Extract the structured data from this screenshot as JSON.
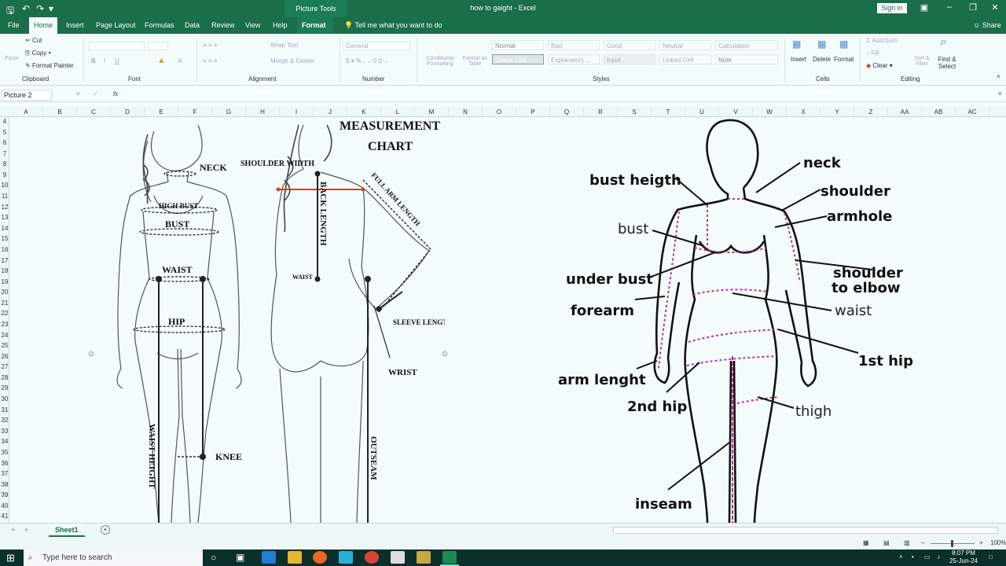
{
  "titlebar": {
    "context_tab": "Picture Tools",
    "document_title": "how to gaight  -  Excel",
    "sign_in": "Sign in"
  },
  "tabs": [
    "File",
    "Home",
    "Insert",
    "Page Layout",
    "Formulas",
    "Data",
    "Review",
    "View",
    "Help",
    "Format"
  ],
  "tell_me": "Tell me what you want to do",
  "share": "Share",
  "ribbon": {
    "clipboard": {
      "label": "Clipboard",
      "cut": "Cut",
      "copy": "Copy",
      "format_painter": "Format Painter",
      "paste": "Paste"
    },
    "font": {
      "label": "Font"
    },
    "alignment": {
      "label": "Alignment",
      "wrap_text": "Wrap Text",
      "merge_center": "Merge & Center"
    },
    "number": {
      "label": "Number",
      "format": "General"
    },
    "styles": {
      "label": "Styles",
      "conditional": "Conditional Formatting",
      "format_as_table": "Format as Table",
      "cells": [
        "Normal",
        "Bad",
        "Good",
        "Neutral",
        "Calculation",
        "Check Cell",
        "Explanatory ...",
        "Input",
        "Linked Cell",
        "Note"
      ]
    },
    "cells": {
      "label": "Cells",
      "insert": "Insert",
      "delete": "Delete",
      "format": "Format"
    },
    "editing": {
      "label": "Editing",
      "autosum": "AutoSum",
      "fill": "Fill",
      "clear": "Clear",
      "sort_filter": "Sort & Filter",
      "find_select": "Find & Select"
    }
  },
  "formula_bar": {
    "name_box": "Picture 2",
    "fx": "fx"
  },
  "columns": [
    "A",
    "B",
    "C",
    "D",
    "E",
    "F",
    "G",
    "H",
    "I",
    "J",
    "K",
    "L",
    "M",
    "N",
    "O",
    "P",
    "Q",
    "R",
    "S",
    "T",
    "U",
    "V",
    "W",
    "X",
    "Y",
    "Z",
    "AA",
    "AB",
    "AC"
  ],
  "rows": [
    "4",
    "5",
    "6",
    "7",
    "8",
    "9",
    "10",
    "11",
    "12",
    "13",
    "14",
    "15",
    "16",
    "17",
    "18",
    "19",
    "20",
    "21",
    "22",
    "23",
    "24",
    "25",
    "26",
    "27",
    "28",
    "29",
    "30",
    "31",
    "32",
    "33",
    "34",
    "35",
    "36",
    "37",
    "38",
    "39",
    "40",
    "41"
  ],
  "left_chart": {
    "title_line1": "MEASUREMENT",
    "title_line2": "CHART",
    "neck": "NECK",
    "high_bust": "HIGH BUST",
    "bust": "BUST",
    "waist": "WAIST",
    "hip": "HIP",
    "knee": "KNEE",
    "waist_height": "WAIST HEIGHT",
    "shoulder_width": "SHOULDER WIDTH",
    "back_length": "BACK LENGTH",
    "full_arm_length": "FULL ARM LENGTH",
    "back_waist": "WAIST",
    "sleeve_length": "SLEEVE LENGTH",
    "wrist": "WRIST",
    "outseam": "OUTSEAM"
  },
  "right_chart": {
    "neck": "neck",
    "bust_height": "bust heigth",
    "shoulder": "shoulder",
    "armhole": "armhole",
    "bust": "bust",
    "shoulder_to_elbow_1": "shoulder",
    "shoulder_to_elbow_2": "to elbow",
    "under_bust": "under bust",
    "forearm": "forearm",
    "waist": "waist",
    "first_hip": "1st hip",
    "arm_length": "arm lenght",
    "second_hip": "2nd hip",
    "thigh": "thigh",
    "inseam": "inseam"
  },
  "sheet_tab": "Sheet1",
  "zoom": "100%",
  "taskbar": {
    "search_placeholder": "Type here to search",
    "time": "8:07 PM",
    "date": "25-Jun-24"
  },
  "colors": {
    "excel_green": "#1a6e4a",
    "tape": "#c03090",
    "shoulder_line": "#c04a2a"
  }
}
